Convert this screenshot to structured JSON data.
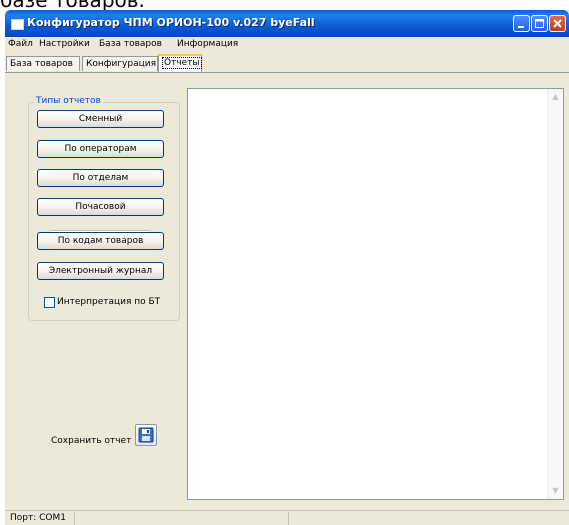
{
  "top_text": "базе товаров.",
  "window": {
    "title": "Конфигуратор ЧПМ ОРИОН-100 v.027 byeFall"
  },
  "menu": [
    "Файл",
    "Настройки",
    "База товаров",
    "Информация"
  ],
  "tabs": [
    "База товаров",
    "Конфигурация",
    "Отчеты"
  ],
  "active_tab": "Отчеты",
  "reports": {
    "group_title": "Типы отчетов",
    "buttons": [
      "Сменный",
      "По операторам",
      "По отделам",
      "Почасовой",
      "По кодам товаров",
      "Электронный журнал"
    ],
    "checkbox_label": "Интерпретация по БТ",
    "checkbox_checked": false
  },
  "save": {
    "label": "Сохранить отчет",
    "icon": "floppy-disk-icon"
  },
  "status": {
    "port": "Порт: COM1"
  },
  "icons": {
    "minimize": "minimize-icon",
    "maximize": "maximize-icon",
    "close": "close-icon"
  },
  "colors": {
    "titlebar": "#0a5fd8",
    "group_title": "#0046d5",
    "close_button": "#c8361b"
  }
}
